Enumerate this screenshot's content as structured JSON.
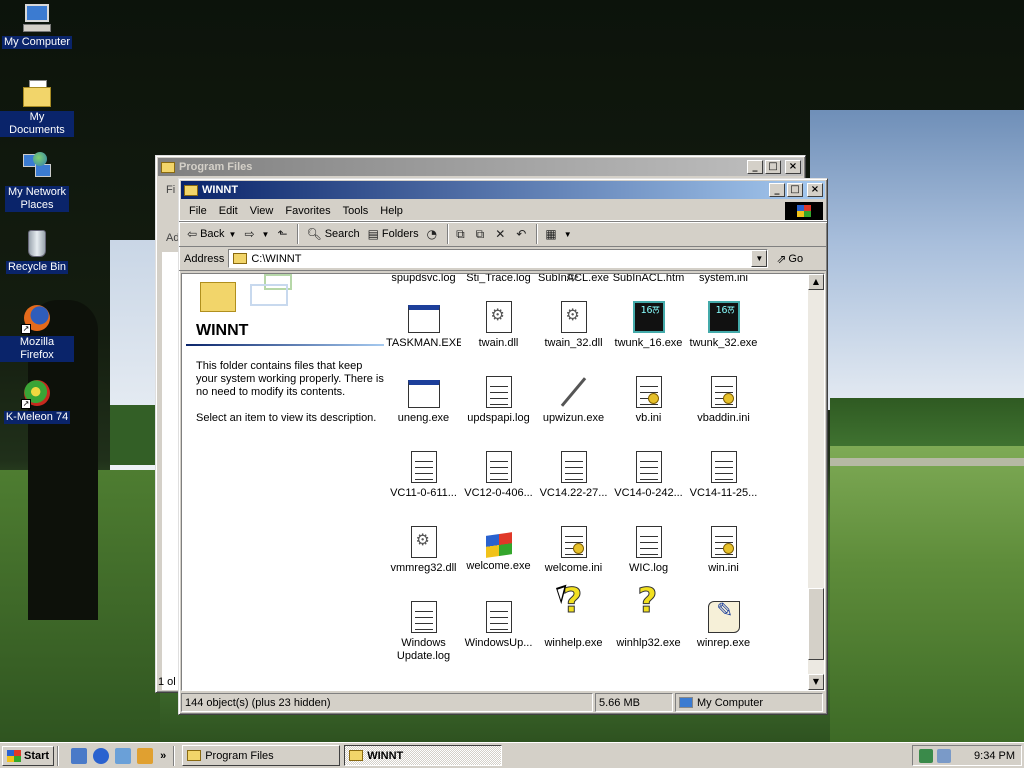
{
  "desktop": {
    "icons": [
      {
        "label": "My Computer",
        "icon": "computer-icon"
      },
      {
        "label": "My Documents",
        "icon": "documents-icon"
      },
      {
        "label": "My Network Places",
        "icon": "network-icon"
      },
      {
        "label": "Recycle Bin",
        "icon": "recycle-bin-icon"
      },
      {
        "label": "Mozilla Firefox",
        "icon": "firefox-icon"
      },
      {
        "label": "K-Meleon 74",
        "icon": "kmeleon-icon"
      }
    ]
  },
  "program_files_window": {
    "title": "Program Files",
    "ghost_menu_letter": "Fi",
    "ghost_addr": "Ad",
    "ghost_status": "1 ol"
  },
  "winnt_window": {
    "title": "WINNT",
    "menu": [
      "File",
      "Edit",
      "View",
      "Favorites",
      "Tools",
      "Help"
    ],
    "toolbar": {
      "back": "Back",
      "search": "Search",
      "folders": "Folders"
    },
    "address_label": "Address",
    "address_value": "C:\\WINNT",
    "go_label": "Go",
    "info_pane": {
      "title": "WINNT",
      "description": "This folder contains files that keep your system working properly. There is no need to modify its contents.",
      "hint": "Select an item to view its description."
    },
    "files": [
      {
        "name": "spupdsvc.log",
        "icon": "text-file-icon"
      },
      {
        "name": "Sti_Trace.log",
        "icon": "text-file-icon"
      },
      {
        "name": "SubInACL.exe",
        "icon": "exe-icon"
      },
      {
        "name": "SubInACL.htm",
        "icon": "html-file-icon"
      },
      {
        "name": "system.ini",
        "icon": "ini-file-icon"
      },
      {
        "name": "TASKMAN.EXE",
        "icon": "window-exe-icon"
      },
      {
        "name": "twain.dll",
        "icon": "dll-file-icon"
      },
      {
        "name": "twain_32.dll",
        "icon": "dll-file-icon"
      },
      {
        "name": "twunk_16.exe",
        "icon": "twunk-icon"
      },
      {
        "name": "twunk_32.exe",
        "icon": "twunk-icon"
      },
      {
        "name": "uneng.exe",
        "icon": "window-exe-icon"
      },
      {
        "name": "updspapi.log",
        "icon": "text-file-icon"
      },
      {
        "name": "upwizun.exe",
        "icon": "wand-icon"
      },
      {
        "name": "vb.ini",
        "icon": "ini-file-icon"
      },
      {
        "name": "vbaddin.ini",
        "icon": "ini-file-icon"
      },
      {
        "name": "VC11-0-611...",
        "icon": "text-file-icon"
      },
      {
        "name": "VC12-0-406...",
        "icon": "text-file-icon"
      },
      {
        "name": "VC14.22-27...",
        "icon": "text-file-icon"
      },
      {
        "name": "VC14-0-242...",
        "icon": "text-file-icon"
      },
      {
        "name": "VC14-11-25...",
        "icon": "text-file-icon"
      },
      {
        "name": "vmmreg32.dll",
        "icon": "dll-file-icon"
      },
      {
        "name": "welcome.exe",
        "icon": "windows-flag-icon"
      },
      {
        "name": "welcome.ini",
        "icon": "ini-file-icon"
      },
      {
        "name": "WIC.log",
        "icon": "text-file-icon"
      },
      {
        "name": "win.ini",
        "icon": "ini-file-icon"
      },
      {
        "name": "Windows Update.log",
        "icon": "text-file-icon"
      },
      {
        "name": "WindowsUp...",
        "icon": "text-file-icon"
      },
      {
        "name": "winhelp.exe",
        "icon": "help-icon"
      },
      {
        "name": "winhlp32.exe",
        "icon": "help-icon"
      },
      {
        "name": "winrep.exe",
        "icon": "winrep-icon"
      }
    ],
    "status": {
      "objects": "144 object(s) (plus 23 hidden)",
      "size": "5.66 MB",
      "zone": "My Computer"
    }
  },
  "taskbar": {
    "start_label": "Start",
    "buttons": [
      {
        "label": "Program Files",
        "pressed": false
      },
      {
        "label": "WINNT",
        "pressed": true
      }
    ],
    "clock": "9:34 PM"
  },
  "colors": {
    "title_active": "#0a246a",
    "window_face": "#d4d0c8",
    "selection": "#0a246a"
  }
}
